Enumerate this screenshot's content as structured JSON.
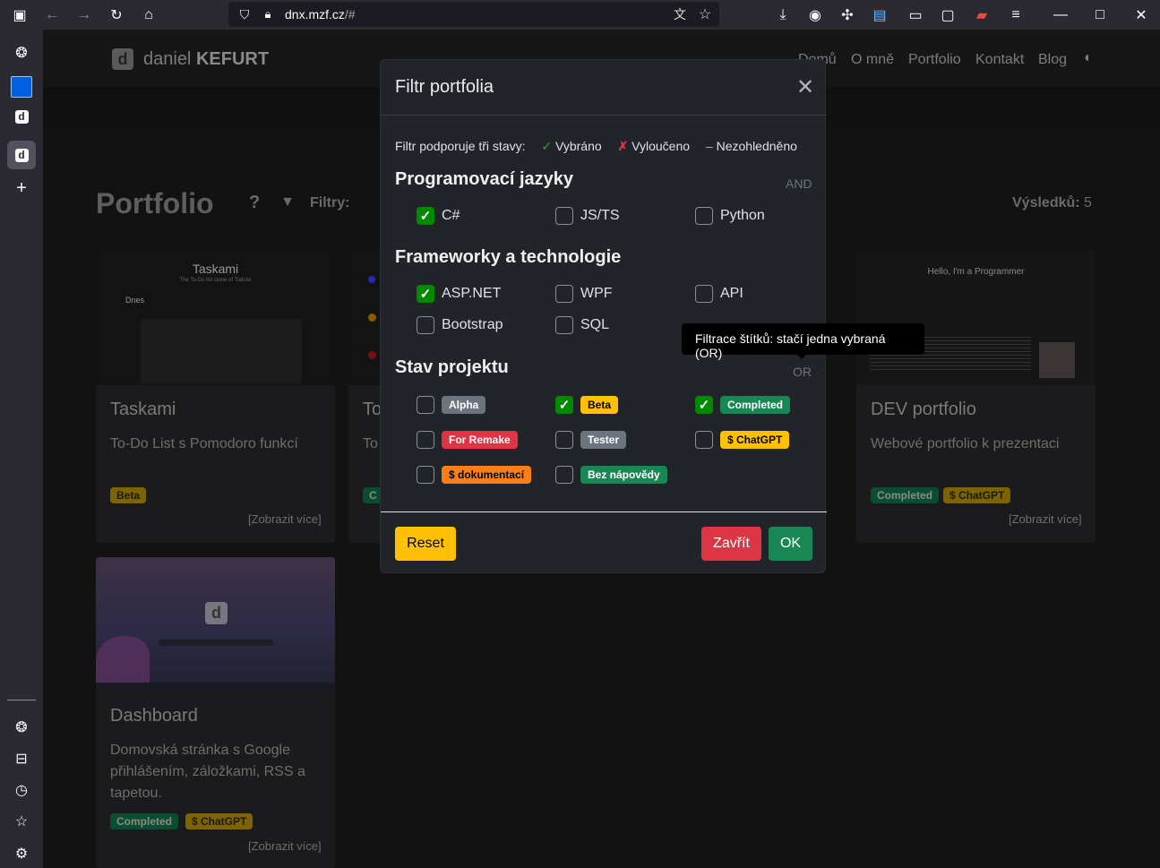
{
  "browser": {
    "url": "dnx.mzf.cz/#",
    "url_domain": "dnx.mzf.cz",
    "url_path": "/#"
  },
  "site": {
    "logo_letter": "d",
    "logo_first": "daniel",
    "logo_last": "KEFURT",
    "nav": [
      "Domů",
      "O mně",
      "Portfolio",
      "Kontakt",
      "Blog"
    ]
  },
  "portfolio": {
    "title": "Portfolio",
    "help": "?",
    "filters_label": "Filtry:",
    "results_label": "Výsledků:",
    "results_count": "5",
    "show_more": "[Zobrazit více]",
    "cards": [
      {
        "title": "Taskami",
        "desc": "To-Do List s Pomodoro funkcí",
        "badges": [
          "Beta"
        ],
        "thumb_title": "Taskami",
        "thumb_sub": "The To-Do list clone of Todoist",
        "thumb_today": "Dnes"
      },
      {
        "title": "To",
        "desc": "To",
        "badges": [
          "C"
        ]
      },
      {
        "title": "DEV portfolio",
        "desc": "Webové portfolio k prezentaci",
        "badges": [
          "Completed",
          "$ ChatGPT"
        ],
        "thumb_title": "Hello, I'm a Programmer"
      },
      {
        "title": "Dashboard",
        "desc": "Domovská stránka s Google přihlášením, záložkami, RSS a tapetou.",
        "badges": [
          "Completed",
          "$ ChatGPT"
        ],
        "thumb_letter": "d"
      }
    ]
  },
  "modal": {
    "title": "Filtr portfolia",
    "intro": "Filtr podporuje tři stavy:",
    "state_selected": "Vybráno",
    "state_excluded": "Vyloučeno",
    "state_ignored": "Nezohledněno",
    "sections": [
      {
        "title": "Programovací jazyky",
        "op": "AND",
        "items": [
          {
            "label": "C#",
            "checked": true
          },
          {
            "label": "JS/TS",
            "checked": false
          },
          {
            "label": "Python",
            "checked": false
          }
        ]
      },
      {
        "title": "Frameworky a technologie",
        "op": "",
        "items": [
          {
            "label": "ASP.NET",
            "checked": true
          },
          {
            "label": "WPF",
            "checked": false
          },
          {
            "label": "API",
            "checked": false
          },
          {
            "label": "Bootstrap",
            "checked": false
          },
          {
            "label": "SQL",
            "checked": false
          }
        ]
      },
      {
        "title": "Stav projektu",
        "op": "OR",
        "items": [
          {
            "label": "Alpha",
            "checked": false
          },
          {
            "label": "Beta",
            "checked": true
          },
          {
            "label": "Completed",
            "checked": true
          },
          {
            "label": "For Remake",
            "checked": false
          },
          {
            "label": "Tester",
            "checked": false
          },
          {
            "label": "$ ChatGPT",
            "checked": false
          },
          {
            "label": "$ dokumentací",
            "checked": false
          },
          {
            "label": "Bez nápovědy",
            "checked": false
          }
        ]
      }
    ],
    "tooltip": "Filtrace štítků: stačí jedna vybraná (OR)",
    "reset": "Reset",
    "close": "Zavřít",
    "ok": "OK"
  },
  "colors": {
    "accent": "#008a00",
    "reset_bg": "#ffc107",
    "close_bg": "#dc3545",
    "ok_bg": "#198754"
  }
}
